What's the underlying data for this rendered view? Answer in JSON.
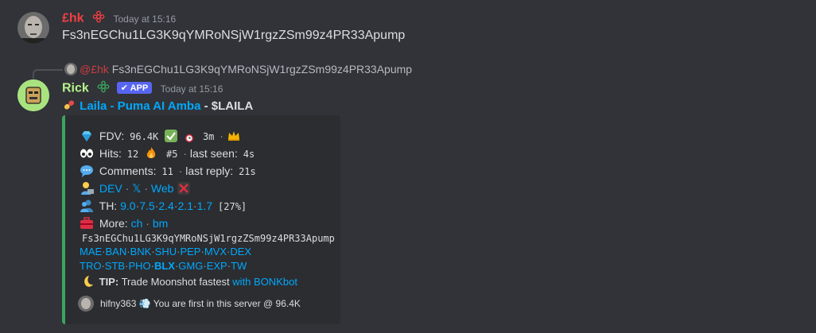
{
  "message1": {
    "username": "£hk",
    "timestamp": "Today at 15:16",
    "content": "Fs3nEGChu1LG3K9qYMRoNSjW1rgzZSm99z4PR33Apump"
  },
  "reply": {
    "mention": "@£hk",
    "content": "Fs3nEGChu1LG3K9qYMRoNSjW1rgzZSm99z4PR33Apump"
  },
  "message2": {
    "username": "Rick",
    "bot_tag": "APP",
    "timestamp": "Today at 15:16",
    "title_link": "Laila - Puma AI Amba",
    "title_sep": " - ",
    "ticker": "$LAILA"
  },
  "embed": {
    "fdv_label": "FDV:",
    "fdv_value": "96.4K",
    "age": "3m",
    "hits_label": "Hits:",
    "hits_value": "12",
    "rank": "#5",
    "last_seen_label": "last seen:",
    "last_seen_value": "4s",
    "comments_label": "Comments:",
    "comments_value": "11",
    "last_reply_label": "last reply:",
    "last_reply_value": "21s",
    "dev_link": "DEV",
    "x_link": "𝕏",
    "web_link": "Web",
    "th_label": "TH:",
    "th_values": [
      "9.0",
      "7.5",
      "2.4",
      "2.1",
      "1.7"
    ],
    "th_total": "[27%]",
    "more_label": "More:",
    "more_links": [
      "ch",
      "bm"
    ],
    "contract": "Fs3nEGChu1LG3K9qYMRoNSjW1rgzZSm99z4PR33Apump",
    "exchanges_row1": [
      "MAE",
      "BAN",
      "BNK",
      "SHU",
      "PEP",
      "MVX",
      "DEX"
    ],
    "exchanges_row2": [
      "TRO",
      "STB",
      "PHO",
      "BLX",
      "GMG",
      "EXP",
      "TW"
    ],
    "tip_label": "TIP:",
    "tip_text": "Trade Moonshot fastest",
    "tip_link": "with BONKbot",
    "footer": "hifny363 💨 You are first in this server @ 96.4K"
  },
  "colors": {
    "user1": "#f23f43",
    "user2": "#b6f38a",
    "link": "#00a8fc",
    "accent": "#3ba55c",
    "app_tag": "#5865f2"
  }
}
